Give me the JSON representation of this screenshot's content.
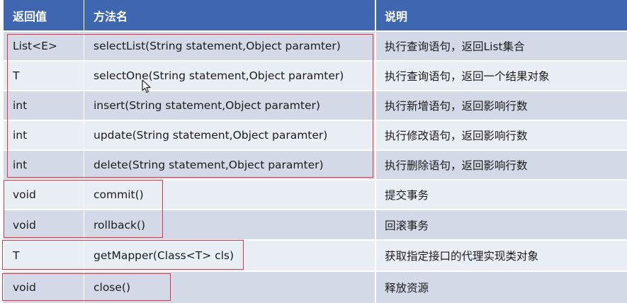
{
  "header": {
    "return_type": "返回值",
    "method_name": "方法名",
    "description": "说明"
  },
  "rows": [
    {
      "return_type": "List<E>",
      "method": "selectList(String statement,Object paramter)",
      "description": "执行查询语句，返回List集合"
    },
    {
      "return_type": "T",
      "method": "selectOne(String statement,Object paramter)",
      "description": "执行查询语句，返回一个结果对象"
    },
    {
      "return_type": "int",
      "method": "insert(String statement,Object paramter)",
      "description": "执行新增语句，返回影响行数"
    },
    {
      "return_type": "int",
      "method": "update(String statement,Object paramter)",
      "description": "执行修改语句，返回影响行数"
    },
    {
      "return_type": "int",
      "method": "delete(String statement,Object paramter)",
      "description": "执行删除语句，返回影响行数"
    },
    {
      "return_type": "void",
      "method": "commit()",
      "description": "提交事务"
    },
    {
      "return_type": "void",
      "method": "rollback()",
      "description": "回滚事务"
    },
    {
      "return_type": "T",
      "method": "getMapper(Class<T> cls)",
      "description": "获取指定接口的代理实现类对象"
    },
    {
      "return_type": "void",
      "method": "close()",
      "description": "释放资源"
    }
  ],
  "colors": {
    "header_bg": "#3f67b1",
    "row_odd": "#d3d9e7",
    "row_even": "#e9edf4",
    "highlight": "#e0353f"
  }
}
